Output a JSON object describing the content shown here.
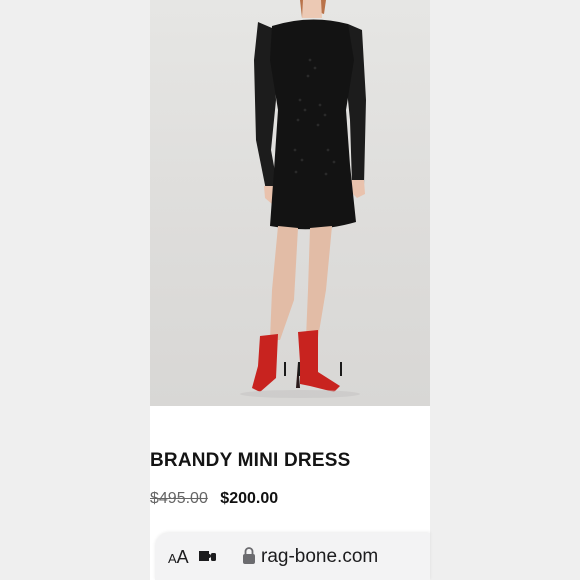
{
  "product": {
    "title": "BRANDY MINI DRESS",
    "original_price": "$495.00",
    "sale_price": "$200.00",
    "image_icon": "product-photo-dress"
  },
  "browser": {
    "text_size_label": "AA",
    "extension_icon": "puzzle-icon",
    "lock_icon": "lock-icon",
    "url": "rag-bone.com"
  },
  "colors": {
    "side_background": "#efefef",
    "dress": "#141414",
    "boots": "#c8231f",
    "text": "#141414"
  }
}
